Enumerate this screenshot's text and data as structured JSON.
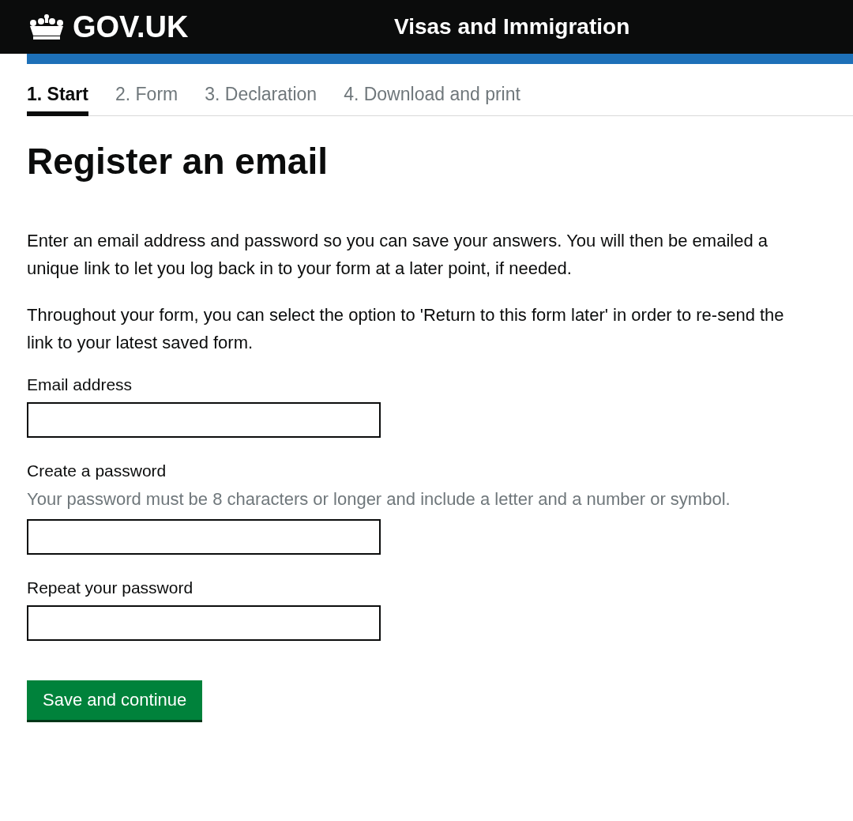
{
  "header": {
    "logo": "GOV.UK",
    "service": "Visas and Immigration"
  },
  "steps": [
    {
      "label": "1. Start",
      "selected": true
    },
    {
      "label": "2. Form",
      "selected": false
    },
    {
      "label": "3. Declaration",
      "selected": false
    },
    {
      "label": "4. Download and print",
      "selected": false
    }
  ],
  "heading": "Register an email",
  "paragraphs": [
    "Enter an email address and password so you can save your answers. You will then be emailed a unique link to let you log back in to your form at a later point, if needed.",
    "Throughout your form, you can select the option to 'Return to this form later' in order to re-send the link to your latest saved form."
  ],
  "fields": [
    {
      "label": "Email address"
    },
    {
      "label": "Create a password",
      "hint": "Your password must be 8 characters or longer and include a letter and a number or symbol."
    },
    {
      "label": "Repeat your password"
    }
  ],
  "button": "Save and continue"
}
